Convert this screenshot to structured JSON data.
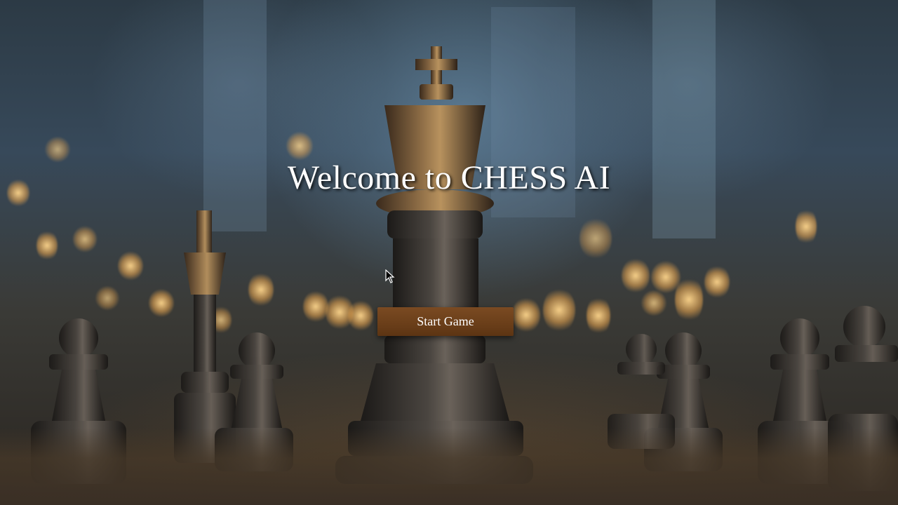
{
  "page": {
    "title": "Welcome to CHESS AI",
    "start_button_label": "Start Game"
  },
  "background": {
    "description_icon": "chess-king-hero-icon"
  },
  "colors": {
    "title_text": "#ffffff",
    "button_bg": "#6a3e19",
    "button_text": "#ffffff"
  }
}
